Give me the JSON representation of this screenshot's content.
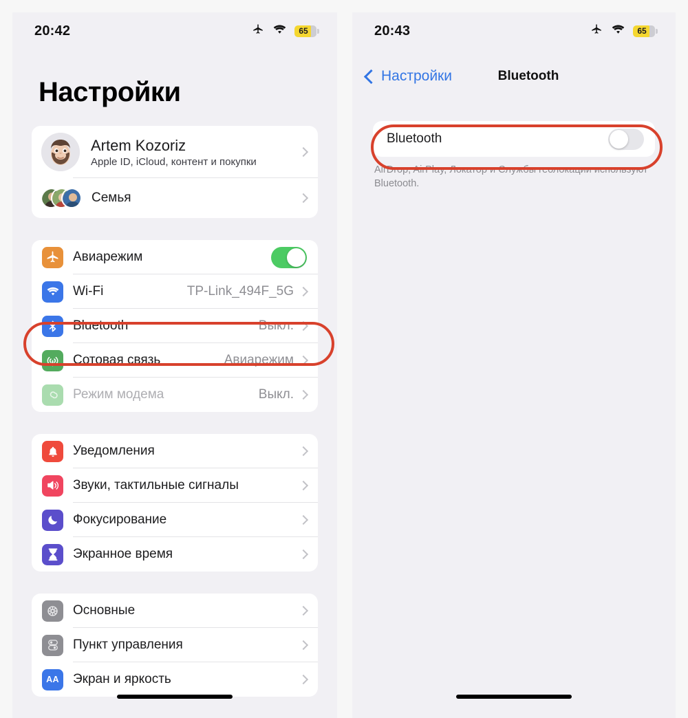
{
  "colors": {
    "page_background": "#f7f7f7",
    "screen_background": "#f1f0f4",
    "card": "#ffffff",
    "accent_blue": "#3275e4",
    "highlight_red": "#d8412c",
    "toggle_on_green": "#4ccb63",
    "toggle_off_gray": "#e6e6ea",
    "battery_yellow": "#f5d730"
  },
  "left_phone": {
    "status_bar": {
      "time": "20:42",
      "airplane_icon": "airplane-mode-icon",
      "wifi_icon": "wifi-icon",
      "battery_level": "65"
    },
    "title": "Настройки",
    "profile": {
      "name": "Artem Kozoriz",
      "subtitle": "Apple ID, iCloud, контент и покупки",
      "avatar_icon": "memoji-avatar",
      "family_label": "Семья",
      "family_avatars_icon": "family-avatars"
    },
    "connectivity": [
      {
        "icon": "airplane-icon",
        "label": "Авиарежим",
        "value": "",
        "control": "toggle-on",
        "dim": false
      },
      {
        "icon": "wifi-icon",
        "label": "Wi-Fi",
        "value": "TP-Link_494F_5G",
        "control": "chevron",
        "dim": false
      },
      {
        "icon": "bluetooth-icon",
        "label": "Bluetooth",
        "value": "Выкл.",
        "control": "chevron",
        "dim": false
      },
      {
        "icon": "cellular-icon",
        "label": "Сотовая связь",
        "value": "Авиарежим",
        "control": "chevron",
        "dim": false
      },
      {
        "icon": "hotspot-icon",
        "label": "Режим модема",
        "value": "Выкл.",
        "control": "chevron",
        "dim": true
      }
    ],
    "notifications": [
      {
        "icon": "bell-icon",
        "label": "Уведомления",
        "value": "",
        "control": "chevron",
        "dim": false
      },
      {
        "icon": "speaker-icon",
        "label": "Звуки, тактильные сигналы",
        "value": "",
        "control": "chevron",
        "dim": false
      },
      {
        "icon": "moon-icon",
        "label": "Фокусирование",
        "value": "",
        "control": "chevron",
        "dim": false
      },
      {
        "icon": "hourglass-icon",
        "label": "Экранное время",
        "value": "",
        "control": "chevron",
        "dim": false
      }
    ],
    "general": [
      {
        "icon": "gear-icon",
        "label": "Основные",
        "value": "",
        "control": "chevron",
        "dim": false
      },
      {
        "icon": "control-center-icon",
        "label": "Пункт управления",
        "value": "",
        "control": "chevron",
        "dim": false
      },
      {
        "icon": "display-aa-icon",
        "label": "Экран и яркость",
        "value": "",
        "control": "chevron",
        "dim": false
      }
    ]
  },
  "right_phone": {
    "status_bar": {
      "time": "20:43",
      "airplane_icon": "airplane-mode-icon",
      "wifi_icon": "wifi-icon",
      "battery_level": "65"
    },
    "nav": {
      "back_label": "Настройки",
      "back_icon": "chevron-left-icon",
      "title": "Bluetooth"
    },
    "bluetooth_row": {
      "label": "Bluetooth",
      "toggle_state": "off"
    },
    "footnote": "AirDrop, AirPlay, Локатор и Службы геолокации используют Bluetooth."
  }
}
